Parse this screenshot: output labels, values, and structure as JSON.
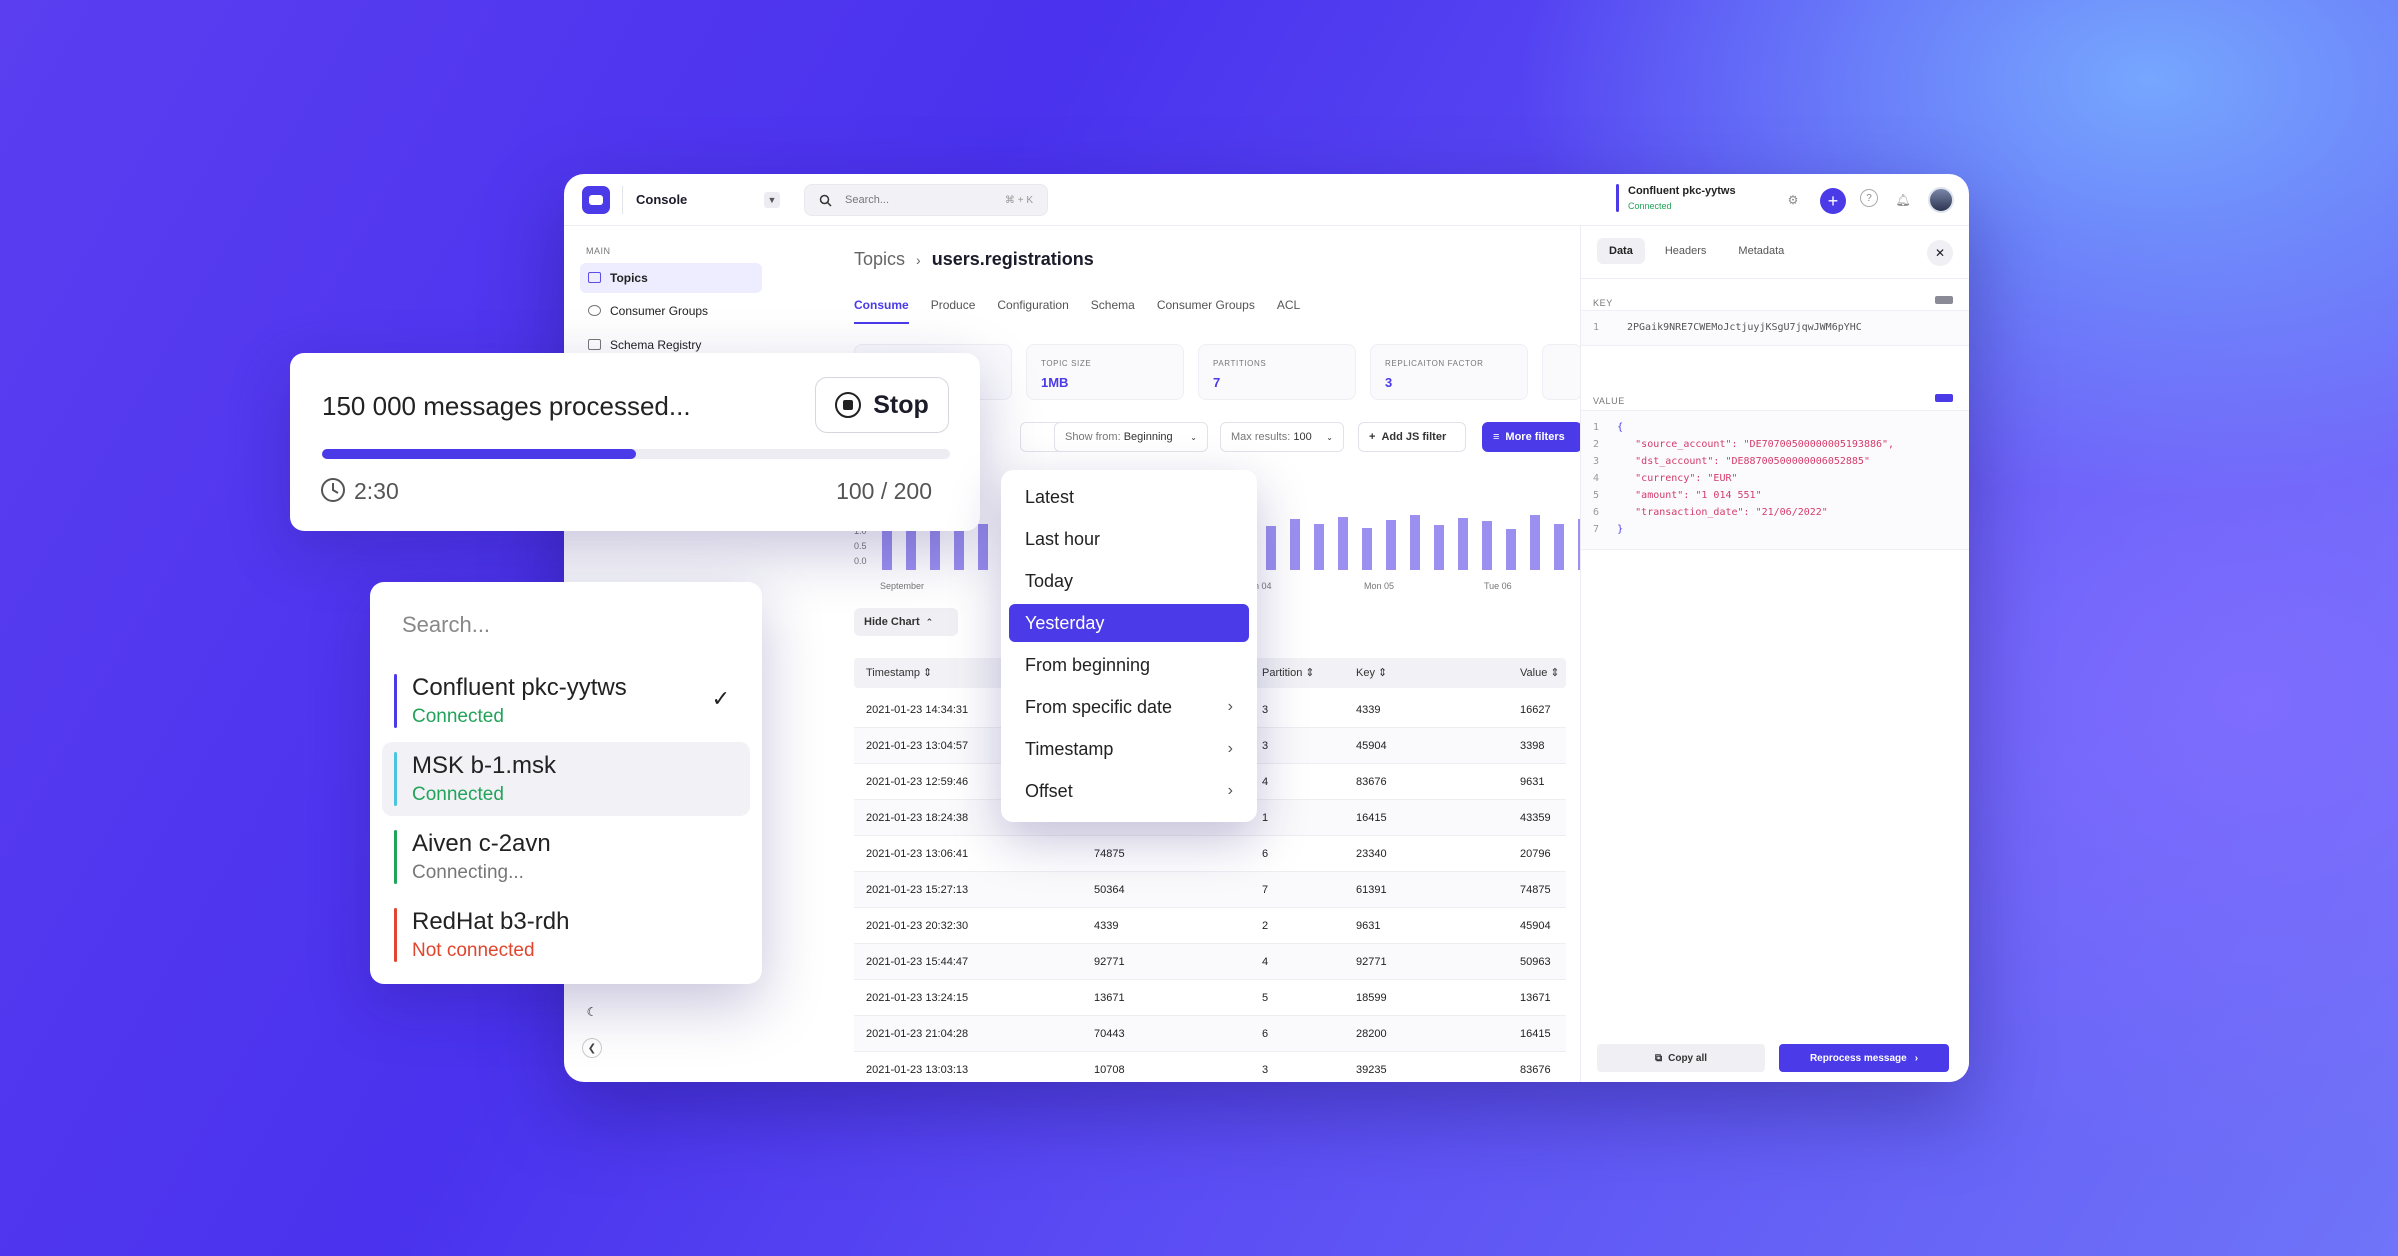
{
  "app": {
    "title": "Console",
    "search_placeholder": "Search...",
    "search_shortcut": "⌘ + K"
  },
  "cluster": {
    "name": "Confluent pkc-yytws",
    "status": "Connected"
  },
  "sidebar": {
    "section": "MAIN",
    "items": [
      {
        "label": "Topics"
      },
      {
        "label": "Consumer Groups"
      },
      {
        "label": "Schema Registry"
      }
    ]
  },
  "breadcrumb": {
    "root": "Topics",
    "current": "users.registrations"
  },
  "tabs": [
    {
      "label": "Consume"
    },
    {
      "label": "Produce"
    },
    {
      "label": "Configuration"
    },
    {
      "label": "Schema"
    },
    {
      "label": "Consumer Groups"
    },
    {
      "label": "ACL"
    }
  ],
  "stats": [
    {
      "label": "TOPIC SIZE",
      "value": "1MB"
    },
    {
      "label": "PARTITIONS",
      "value": "7"
    },
    {
      "label": "REPLICAITON FACTOR",
      "value": "3"
    }
  ],
  "filters": {
    "show_from_label": "Show from:",
    "show_from_value": "Beginning",
    "max_label": "Max results:",
    "max_value": "100",
    "add_js": "Add JS filter",
    "more": "More filters"
  },
  "chart_data": {
    "type": "bar",
    "ylim": [
      0,
      1.0
    ],
    "y_ticks": [
      "1.0",
      "0.5",
      "0.0"
    ],
    "x_ticks": [
      "September",
      "n 04",
      "Mon 05",
      "Tue 06"
    ],
    "values": [
      0.82,
      0.9,
      0.75,
      0.95,
      0.8,
      0.88,
      0.7,
      0.92,
      0.84,
      0.78,
      0.96,
      0.86,
      0.74,
      0.9,
      0.82,
      0.94,
      0.76,
      0.88,
      0.8,
      0.92,
      0.72,
      0.86,
      0.94,
      0.78,
      0.9,
      0.84,
      0.7,
      0.95,
      0.8,
      0.88
    ]
  },
  "hide_chart": "Hide Chart",
  "table": {
    "headers": [
      "Timestamp",
      "Partition",
      "Key",
      "Value"
    ],
    "rows": [
      [
        "2021-01-23  14:34:31",
        "",
        "3",
        "4339",
        "16627"
      ],
      [
        "2021-01-23  13:04:57",
        "",
        "3",
        "45904",
        "3398"
      ],
      [
        "2021-01-23  12:59:46",
        "",
        "4",
        "83676",
        "9631"
      ],
      [
        "2021-01-23  18:24:38",
        "",
        "1",
        "16415",
        "43359"
      ],
      [
        "2021-01-23  13:06:41",
        "74875",
        "6",
        "23340",
        "20796"
      ],
      [
        "2021-01-23  15:27:13",
        "50364",
        "7",
        "61391",
        "74875"
      ],
      [
        "2021-01-23  20:32:30",
        "4339",
        "2",
        "9631",
        "45904"
      ],
      [
        "2021-01-23  15:44:47",
        "92771",
        "4",
        "92771",
        "50963"
      ],
      [
        "2021-01-23  13:24:15",
        "13671",
        "5",
        "18599",
        "13671"
      ],
      [
        "2021-01-23  21:04:28",
        "70443",
        "6",
        "28200",
        "16415"
      ],
      [
        "2021-01-23  13:03:13",
        "10708",
        "3",
        "39235",
        "83676"
      ]
    ]
  },
  "panel": {
    "tabs": [
      "Data",
      "Headers",
      "Metadata"
    ],
    "key_label": "KEY",
    "key_value": "2PGaik9NRE7CWEMoJctjuyjKSgU7jqwJWM6pYHC",
    "value_label": "VALUE",
    "json_lines": [
      {
        "n": "1",
        "k": "",
        "v": "{"
      },
      {
        "n": "2",
        "k": "\"source_account\": ",
        "v": "\"DE70700500000005193886\","
      },
      {
        "n": "3",
        "k": "\"dst_account\": ",
        "v": "\"DE88700500000006052885\""
      },
      {
        "n": "4",
        "k": "\"currency\": ",
        "v": "\"EUR\""
      },
      {
        "n": "5",
        "k": "\"amount\": ",
        "v": "\"1 014 551\""
      },
      {
        "n": "6",
        "k": "\"transaction_date\": ",
        "v": "\"21/06/2022\""
      },
      {
        "n": "7",
        "k": "",
        "v": "}"
      }
    ],
    "copy_all": "Copy all",
    "reprocess": "Reprocess message"
  },
  "progress": {
    "title": "150 000 messages processed...",
    "stop": "Stop",
    "elapsed": "2:30",
    "count": "100 / 200",
    "fraction": 0.5
  },
  "cluster_dropdown": {
    "placeholder": "Search...",
    "items": [
      {
        "name": "Confluent pkc-yytws",
        "status": "Connected",
        "color": "#4b3ae8",
        "status_color": "#22a35a",
        "checked": true
      },
      {
        "name": "MSK b-1.msk",
        "status": "Connected",
        "color": "#4cc3e0",
        "status_color": "#22a35a"
      },
      {
        "name": "Aiven c-2avn",
        "status": "Connecting...",
        "color": "#22a35a",
        "status_color": "#777777"
      },
      {
        "name": "RedHat b3-rdh",
        "status": "Not connected",
        "color": "#e0452d",
        "status_color": "#e0452d"
      }
    ]
  },
  "time_menu": {
    "items": [
      {
        "label": "Latest"
      },
      {
        "label": "Last hour"
      },
      {
        "label": "Today"
      },
      {
        "label": "Yesterday",
        "selected": true
      },
      {
        "label": "From beginning"
      },
      {
        "label": "From specific date",
        "sub": true
      },
      {
        "label": "Timestamp",
        "sub": true
      },
      {
        "label": "Offset",
        "sub": true
      }
    ]
  },
  "colors": {
    "accent": "#4b3ae8",
    "connected": "#22a35a",
    "error": "#e0452d"
  }
}
